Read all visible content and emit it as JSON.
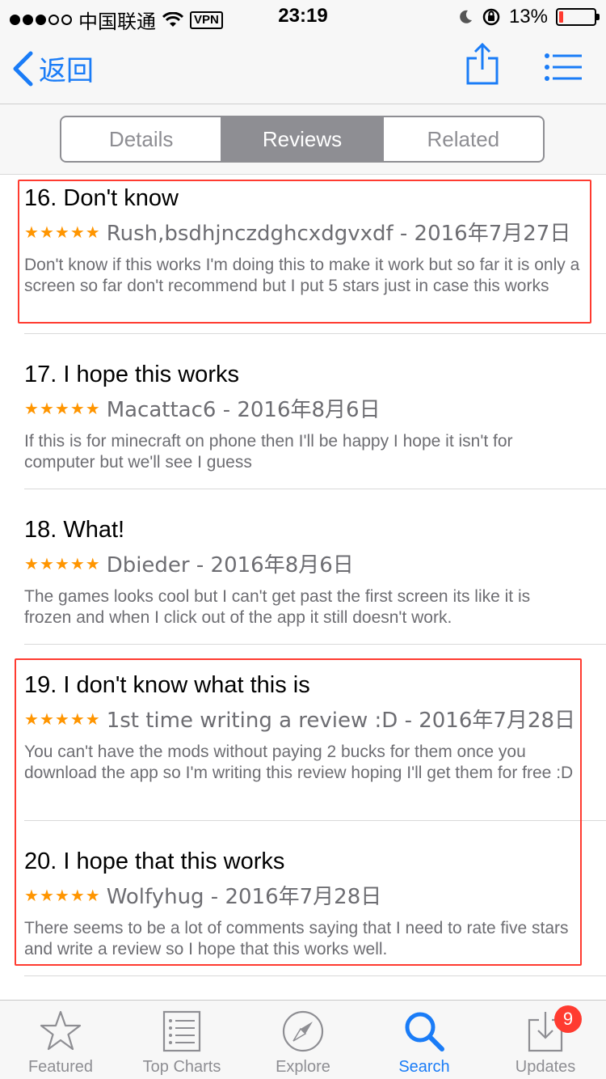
{
  "status_bar": {
    "carrier": "中国联通",
    "vpn": "VPN",
    "time": "23:19",
    "battery_percent": "13%",
    "battery_level": 0.13,
    "battery_color": "#ff3b30"
  },
  "nav": {
    "back_label": "返回",
    "accent_color": "#1a7cf7",
    "share_icon": "share-icon",
    "list_icon": "list-icon"
  },
  "segments": [
    {
      "label": "Details",
      "active": false
    },
    {
      "label": "Reviews",
      "active": true
    },
    {
      "label": "Related",
      "active": false
    }
  ],
  "reviews": [
    {
      "title": "16. Don't know",
      "stars": 5,
      "author_date": "Rush,bsdhjnczdghcxdgvxdf - 2016年7月27日",
      "body": "Don't know if this works I'm doing this to make it work but so far it is only a screen so far don't recommend but I put 5 stars just in case this works"
    },
    {
      "title": "17. I hope this works",
      "stars": 5,
      "author_date": "Macattac6 - 2016年8月6日",
      "body": "If this is for minecraft on phone then I'll be happy I hope it isn't for computer but we'll see I guess"
    },
    {
      "title": "18. What!",
      "stars": 5,
      "author_date": "Dbieder - 2016年8月6日",
      "body": "The games looks cool but I can't get past the first screen its like it is frozen and when I click out of the app it still doesn't work."
    },
    {
      "title": "19. I don't know what this is",
      "stars": 5,
      "author_date": "1st time writing a review :D - 2016年7月28日",
      "body": "You can't have the mods without paying 2 bucks for them once you download the app so I'm writing this review hoping I'll get them for free :D"
    },
    {
      "title": "20. I hope that this works",
      "stars": 5,
      "author_date": "Wolfyhug - 2016年7月28日",
      "body": "There seems to be a lot of comments saying that I need to rate five stars and write a review so I hope that this works well."
    }
  ],
  "star_color": "#ff9500",
  "highlight_color": "#ff3b30",
  "tabs": [
    {
      "label": "Featured",
      "icon": "star-icon",
      "active": false
    },
    {
      "label": "Top Charts",
      "icon": "top-charts-icon",
      "active": false
    },
    {
      "label": "Explore",
      "icon": "compass-icon",
      "active": false
    },
    {
      "label": "Search",
      "icon": "search-icon",
      "active": true
    },
    {
      "label": "Updates",
      "icon": "updates-icon",
      "active": false,
      "badge": "9"
    }
  ]
}
